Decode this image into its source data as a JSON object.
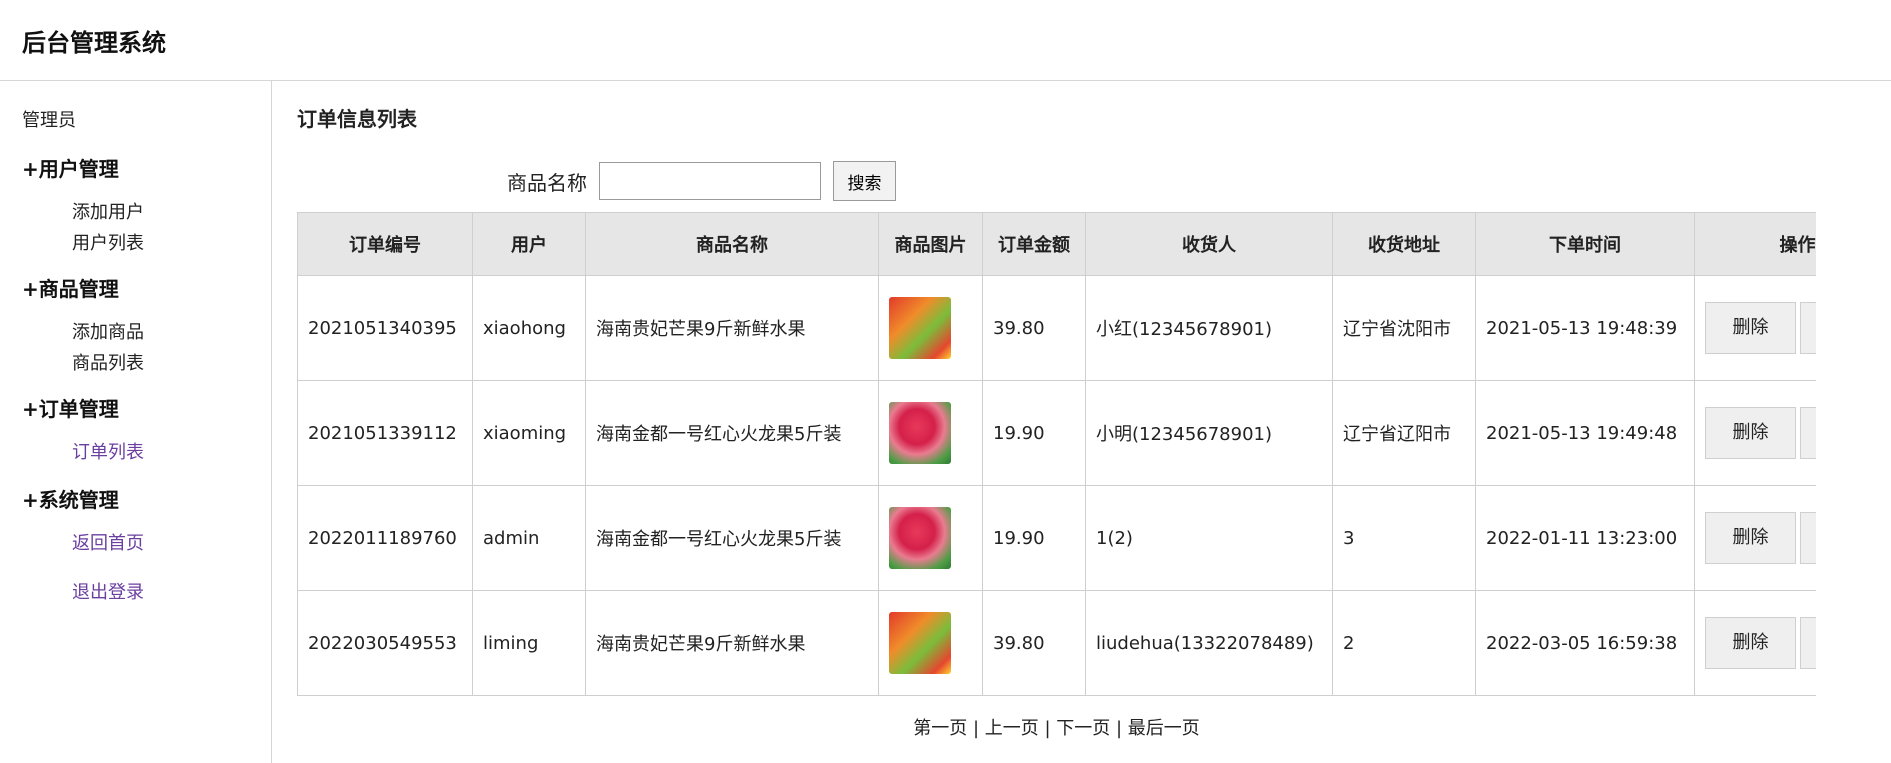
{
  "app": {
    "title": "后台管理系统"
  },
  "sidebar": {
    "role": "管理员",
    "groups": [
      {
        "label": "+用户管理",
        "items": [
          "添加用户",
          "用户列表"
        ]
      },
      {
        "label": "+商品管理",
        "items": [
          "添加商品",
          "商品列表"
        ]
      },
      {
        "label": "+订单管理",
        "items": [
          "订单列表"
        ]
      },
      {
        "label": "+系统管理",
        "items": [
          "返回首页",
          "退出登录"
        ]
      }
    ]
  },
  "main": {
    "title": "订单信息列表",
    "search": {
      "label": "商品名称",
      "value": "",
      "placeholder": "",
      "button": "搜索"
    },
    "columns": [
      "订单编号",
      "用户",
      "商品名称",
      "商品图片",
      "订单金额",
      "收货人",
      "收货地址",
      "下单时间",
      "操作"
    ],
    "rows": [
      {
        "id": "2021051340395",
        "user": "xiaohong",
        "product": "海南贵妃芒果9斤新鲜水果",
        "image": "mango-image",
        "amount": "39.80",
        "receiver": "小红(12345678901)",
        "address": "辽宁省沈阳市",
        "time": "2021-05-13 19:48:39",
        "op": "删除"
      },
      {
        "id": "2021051339112",
        "user": "xiaoming",
        "product": "海南金都一号红心火龙果5斤装",
        "image": "dragonfruit-image",
        "amount": "19.90",
        "receiver": "小明(12345678901)",
        "address": "辽宁省辽阳市",
        "time": "2021-05-13 19:49:48",
        "op": "删除"
      },
      {
        "id": "2022011189760",
        "user": "admin",
        "product": "海南金都一号红心火龙果5斤装",
        "image": "dragonfruit-image",
        "amount": "19.90",
        "receiver": "1(2)",
        "address": "3",
        "time": "2022-01-11 13:23:00",
        "op": "删除"
      },
      {
        "id": "2022030549553",
        "user": "liming",
        "product": "海南贵妃芒果9斤新鲜水果",
        "image": "mango-image",
        "amount": "39.80",
        "receiver": "liudehua(13322078489)",
        "address": "2",
        "time": "2022-03-05 16:59:38",
        "op": "删除"
      }
    ],
    "pager": {
      "first": "第一页",
      "prev": "上一页",
      "next": "下一页",
      "last": "最后一页",
      "sep": " | "
    }
  }
}
